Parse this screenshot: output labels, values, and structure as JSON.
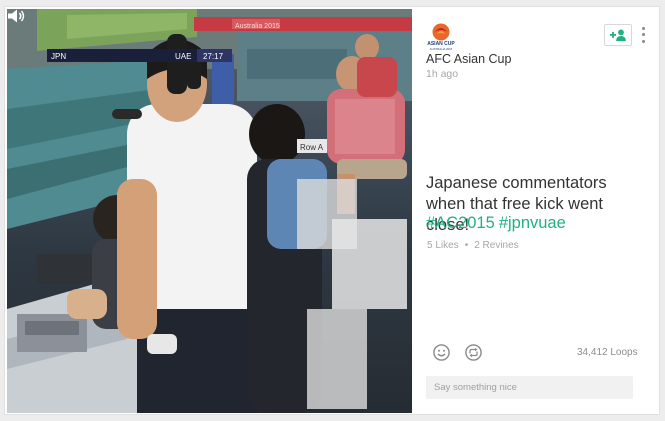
{
  "video": {
    "scoreboard_team_left": "JPN",
    "scoreboard_team_right": "UAE",
    "scoreboard_clock": "27:17",
    "sideline_board_text": "Australia 2015",
    "sign_text": "Row A",
    "icons": {
      "volume": "speaker-icon"
    }
  },
  "channel": {
    "name": "AFC Asian Cup",
    "logo_text": "ASIAN CUP",
    "logo_sub": "AUSTRALIA 2015",
    "time": "1h ago"
  },
  "post": {
    "caption": "Japanese commentators when that free kick went close!",
    "hashtags": [
      "#AC2015",
      "#jpnvuae"
    ],
    "likes": "5 Likes",
    "separator": "•",
    "revines": "2 Revines",
    "loops": "34,412 Loops"
  },
  "comment": {
    "placeholder": "Say something nice"
  },
  "icons": {
    "follow": "add-user-icon",
    "more": "vertical-dots-icon",
    "like": "smile-icon",
    "revine": "revine-icon"
  },
  "colors": {
    "accent": "#1fb27e",
    "text": "#333333",
    "muted": "#a6a6a6"
  }
}
